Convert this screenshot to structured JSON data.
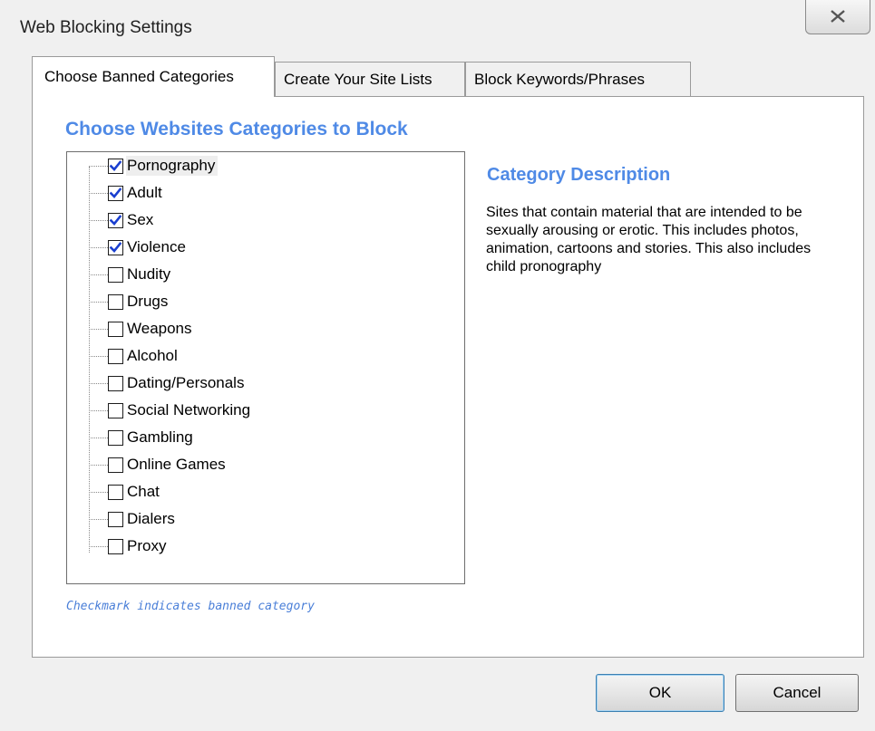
{
  "window": {
    "title": "Web Blocking Settings",
    "close_icon": "close-icon"
  },
  "tabs": [
    {
      "label": "Choose Banned Categories",
      "active": true
    },
    {
      "label": "Create Your Site Lists",
      "active": false
    },
    {
      "label": "Block Keywords/Phrases",
      "active": false
    }
  ],
  "panel": {
    "heading": "Choose Websites Categories to Block",
    "categories": [
      {
        "label": "Pornography",
        "checked": true,
        "selected": true
      },
      {
        "label": "Adult",
        "checked": true
      },
      {
        "label": "Sex",
        "checked": true
      },
      {
        "label": "Violence",
        "checked": true
      },
      {
        "label": "Nudity",
        "checked": false
      },
      {
        "label": "Drugs",
        "checked": false
      },
      {
        "label": "Weapons",
        "checked": false
      },
      {
        "label": "Alcohol",
        "checked": false
      },
      {
        "label": "Dating/Personals",
        "checked": false
      },
      {
        "label": "Social Networking",
        "checked": false
      },
      {
        "label": "Gambling",
        "checked": false
      },
      {
        "label": "Online Games",
        "checked": false
      },
      {
        "label": "Chat",
        "checked": false
      },
      {
        "label": "Dialers",
        "checked": false
      },
      {
        "label": "Proxy",
        "checked": false
      }
    ],
    "description_title": "Category Description",
    "description_text": "Sites that contain material that are intended to be sexually arousing or erotic. This includes photos, animation, cartoons and stories. This also includes child pronography",
    "footnote": "Checkmark indicates banned category"
  },
  "buttons": {
    "ok_label": "OK",
    "cancel_label": "Cancel"
  },
  "colors": {
    "heading_blue": "#4f8ae6",
    "checkmark_blue": "#1a3fd0"
  }
}
